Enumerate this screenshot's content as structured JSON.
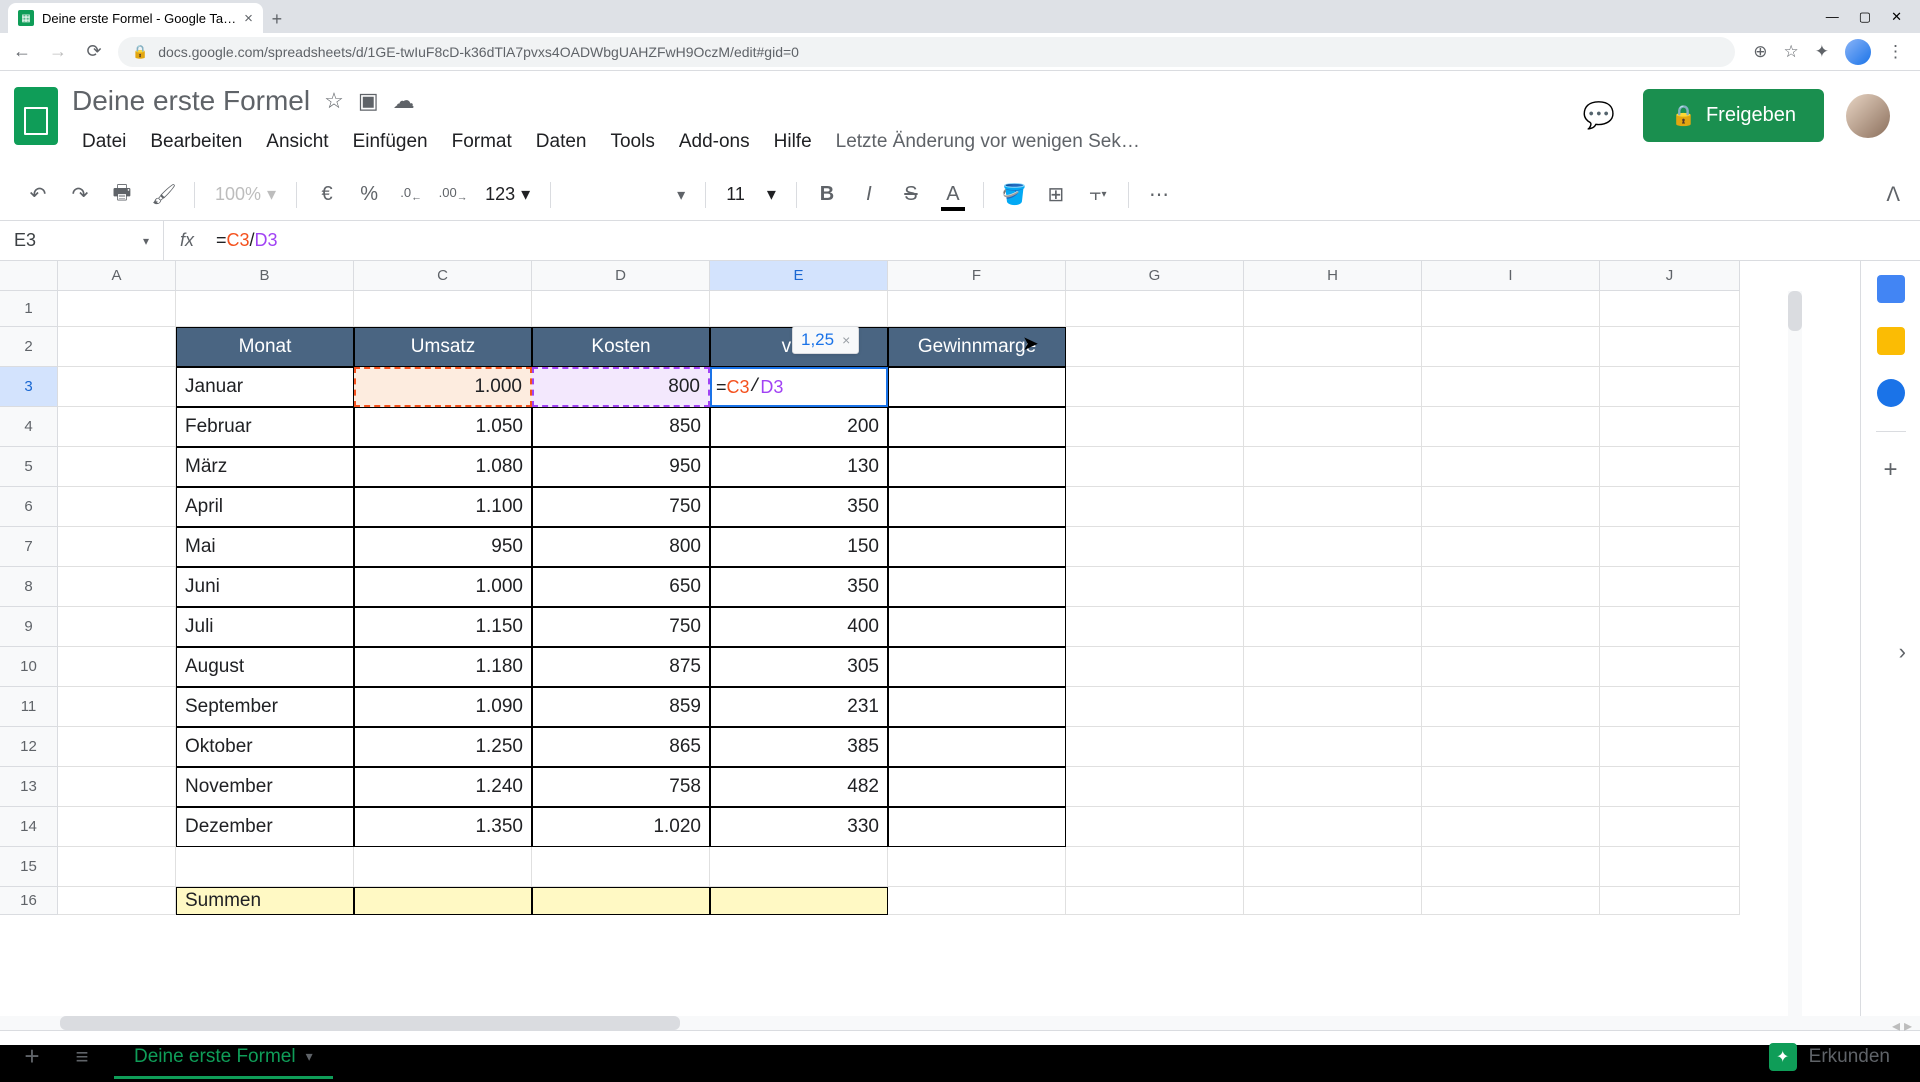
{
  "browser": {
    "tab_title": "Deine erste Formel - Google Ta…",
    "url": "docs.google.com/spreadsheets/d/1GE-twIuF8cD-k36dTlA7pvxs4OADWbgUAHZFwH9OczM/edit#gid=0"
  },
  "doc": {
    "title": "Deine erste Formel",
    "last_edit": "Letzte Änderung vor wenigen Sek…",
    "share_label": "Freigeben"
  },
  "menu": {
    "file": "Datei",
    "edit": "Bearbeiten",
    "view": "Ansicht",
    "insert": "Einfügen",
    "format": "Format",
    "data": "Daten",
    "tools": "Tools",
    "addons": "Add-ons",
    "help": "Hilfe"
  },
  "toolbar": {
    "zoom": "100%",
    "currency": "€",
    "percent": "%",
    "dec_less": ".0",
    "dec_more": ".00",
    "number_format": "123",
    "font_size": "11"
  },
  "formula": {
    "cell_ref": "E3",
    "eq": "=",
    "ref1": "C3",
    "op": "/",
    "ref2": "D3",
    "preview_value": "1,25"
  },
  "columns": [
    "A",
    "B",
    "C",
    "D",
    "E",
    "F",
    "G",
    "H",
    "I",
    "J"
  ],
  "row_numbers": [
    "1",
    "2",
    "3",
    "4",
    "5",
    "6",
    "7",
    "8",
    "9",
    "10",
    "11",
    "12",
    "13",
    "14",
    "15",
    "16"
  ],
  "headers": {
    "monat": "Monat",
    "umsatz": "Umsatz",
    "kosten": "Kosten",
    "gewinn_partial": "vinn",
    "gewinnmarge": "Gewinnmarge"
  },
  "table": [
    {
      "monat": "Januar",
      "umsatz": "1.000",
      "kosten": "800",
      "gewinn": "",
      "editing": true
    },
    {
      "monat": "Februar",
      "umsatz": "1.050",
      "kosten": "850",
      "gewinn": "200"
    },
    {
      "monat": "März",
      "umsatz": "1.080",
      "kosten": "950",
      "gewinn": "130"
    },
    {
      "monat": "April",
      "umsatz": "1.100",
      "kosten": "750",
      "gewinn": "350"
    },
    {
      "monat": "Mai",
      "umsatz": "950",
      "kosten": "800",
      "gewinn": "150"
    },
    {
      "monat": "Juni",
      "umsatz": "1.000",
      "kosten": "650",
      "gewinn": "350"
    },
    {
      "monat": "Juli",
      "umsatz": "1.150",
      "kosten": "750",
      "gewinn": "400"
    },
    {
      "monat": "August",
      "umsatz": "1.180",
      "kosten": "875",
      "gewinn": "305"
    },
    {
      "monat": "September",
      "umsatz": "1.090",
      "kosten": "859",
      "gewinn": "231"
    },
    {
      "monat": "Oktober",
      "umsatz": "1.250",
      "kosten": "865",
      "gewinn": "385"
    },
    {
      "monat": "November",
      "umsatz": "1.240",
      "kosten": "758",
      "gewinn": "482"
    },
    {
      "monat": "Dezember",
      "umsatz": "1.350",
      "kosten": "1.020",
      "gewinn": "330"
    }
  ],
  "summen_label": "Summen",
  "sheet_tab": "Deine erste Formel",
  "explore_label": "Erkunden"
}
